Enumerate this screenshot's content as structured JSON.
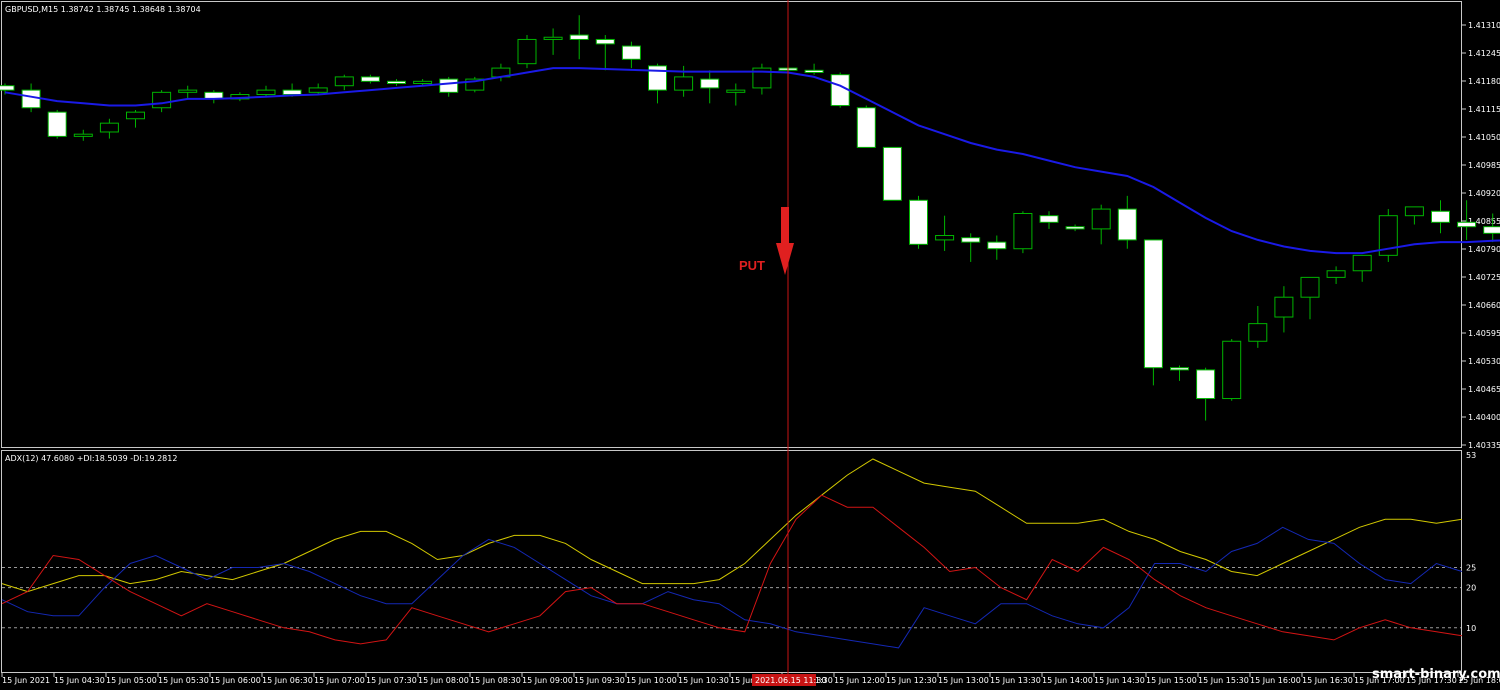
{
  "header": {
    "symbol_info": "GBPUSD,M15  1.38742 1.38745 1.38648 1.38704",
    "adx_info": "ADX(12) 47.6080 +DI:18.5039 -DI:19.2812"
  },
  "signal": {
    "label": "PUT",
    "direction": "down"
  },
  "cursor_time": "2021.06.15 11:30",
  "watermark": "smart-binary.com",
  "colors": {
    "background": "#000000",
    "bull": "#00b400",
    "bear_fill": "#ffffff",
    "ma": "#1a1ae6",
    "adx": "#d2c800",
    "plus_di": "#1428b4",
    "minus_di": "#d21414",
    "cursor": "#c81414",
    "signal": "#e02020"
  },
  "axes": {
    "price_labels": [
      "1.41310",
      "1.41245",
      "1.41180",
      "1.41115",
      "1.41050",
      "1.40985",
      "1.40920",
      "1.40855",
      "1.40790",
      "1.40725",
      "1.40660",
      "1.40595",
      "1.40530",
      "1.40465",
      "1.40400",
      "1.40335"
    ],
    "adx_labels": [
      "53",
      "25",
      "20",
      "10"
    ],
    "adx_levels": [
      25,
      20,
      10
    ],
    "time_labels": [
      "15 Jun 2021",
      "15 Jun 04:30",
      "15 Jun 05:00",
      "15 Jun 05:30",
      "15 Jun 06:00",
      "15 Jun 06:30",
      "15 Jun 07:00",
      "15 Jun 07:30",
      "15 Jun 08:00",
      "15 Jun 08:30",
      "15 Jun 09:00",
      "15 Jun 09:30",
      "15 Jun 10:00",
      "15 Jun 10:30",
      "15 Jun 11:00",
      "15 Jun 11:30",
      "15 Jun 12:00",
      "15 Jun 12:30",
      "15 Jun 13:00",
      "15 Jun 13:30",
      "15 Jun 14:00",
      "15 Jun 14:30",
      "15 Jun 15:00",
      "15 Jun 15:30",
      "15 Jun 16:00",
      "15 Jun 16:30",
      "15 Jun 17:00",
      "15 Jun 17:30",
      "15 Jun 18:00"
    ]
  },
  "chart_data": {
    "type": "candlestick",
    "price_range": [
      1.4032,
      1.4133
    ],
    "adx_range": [
      0,
      53
    ],
    "signal_index": 30,
    "candles": [
      [
        1.4114,
        1.41145,
        1.4112,
        1.4113
      ],
      [
        1.4113,
        1.41145,
        1.4108,
        1.4109
      ],
      [
        1.4108,
        1.41085,
        1.4102,
        1.41025
      ],
      [
        1.41025,
        1.4104,
        1.41015,
        1.4103
      ],
      [
        1.41035,
        1.41065,
        1.4102,
        1.41055
      ],
      [
        1.41065,
        1.41085,
        1.41045,
        1.4108
      ],
      [
        1.4109,
        1.4113,
        1.4108,
        1.41125
      ],
      [
        1.41125,
        1.4114,
        1.4111,
        1.4113
      ],
      [
        1.41125,
        1.4113,
        1.411,
        1.4111
      ],
      [
        1.4111,
        1.41125,
        1.41105,
        1.4112
      ],
      [
        1.4112,
        1.4114,
        1.41115,
        1.4113
      ],
      [
        1.4113,
        1.41145,
        1.41115,
        1.4112
      ],
      [
        1.41125,
        1.41145,
        1.4112,
        1.41135
      ],
      [
        1.4114,
        1.41165,
        1.4113,
        1.4116
      ],
      [
        1.4116,
        1.41165,
        1.41145,
        1.4115
      ],
      [
        1.4115,
        1.41155,
        1.4114,
        1.41145
      ],
      [
        1.41145,
        1.41155,
        1.4114,
        1.4115
      ],
      [
        1.41155,
        1.4116,
        1.41115,
        1.41125
      ],
      [
        1.4113,
        1.4116,
        1.41125,
        1.41155
      ],
      [
        1.4116,
        1.4119,
        1.4115,
        1.4118
      ],
      [
        1.4119,
        1.41255,
        1.4118,
        1.41245
      ],
      [
        1.41245,
        1.4127,
        1.4121,
        1.4125
      ],
      [
        1.41255,
        1.413,
        1.412,
        1.41245
      ],
      [
        1.41245,
        1.41255,
        1.41175,
        1.41235
      ],
      [
        1.4123,
        1.4124,
        1.4118,
        1.412
      ],
      [
        1.41185,
        1.4119,
        1.411,
        1.4113
      ],
      [
        1.4113,
        1.41185,
        1.41115,
        1.4116
      ],
      [
        1.41155,
        1.41175,
        1.411,
        1.41135
      ],
      [
        1.41125,
        1.41145,
        1.41095,
        1.4113
      ],
      [
        1.41135,
        1.4119,
        1.4112,
        1.4118
      ],
      [
        1.4118,
        1.4119,
        1.4114,
        1.41175
      ],
      [
        1.41175,
        1.4119,
        1.41165,
        1.4117
      ],
      [
        1.41165,
        1.4117,
        1.4109,
        1.41095
      ],
      [
        1.4109,
        1.41095,
        1.41035,
        1.41
      ],
      [
        1.41,
        1.4099,
        1.40935,
        1.4088
      ],
      [
        1.4088,
        1.4089,
        1.4077,
        1.4078
      ],
      [
        1.4079,
        1.40845,
        1.40765,
        1.408
      ],
      [
        1.40795,
        1.40805,
        1.4074,
        1.40785
      ],
      [
        1.40785,
        1.408,
        1.40745,
        1.4077
      ],
      [
        1.4077,
        1.40855,
        1.4076,
        1.4085
      ],
      [
        1.40845,
        1.40855,
        1.40815,
        1.4083
      ],
      [
        1.4082,
        1.40825,
        1.4081,
        1.40815
      ],
      [
        1.40815,
        1.4087,
        1.4078,
        1.4086
      ],
      [
        1.4086,
        1.4089,
        1.4077,
        1.4079
      ],
      [
        1.4079,
        1.4079,
        1.4046,
        1.405
      ],
      [
        1.405,
        1.40505,
        1.4047,
        1.40495
      ],
      [
        1.40495,
        1.405,
        1.4038,
        1.4043
      ],
      [
        1.4043,
        1.40565,
        1.40425,
        1.4056
      ],
      [
        1.4056,
        1.4064,
        1.40545,
        1.406
      ],
      [
        1.40615,
        1.40685,
        1.4058,
        1.4066
      ],
      [
        1.4066,
        1.40705,
        1.4061,
        1.40705
      ],
      [
        1.40705,
        1.4073,
        1.4069,
        1.4072
      ],
      [
        1.4072,
        1.4075,
        1.40695,
        1.40755
      ],
      [
        1.40755,
        1.4086,
        1.4074,
        1.40845
      ],
      [
        1.40845,
        1.4086,
        1.40825,
        1.40865
      ],
      [
        1.40855,
        1.4088,
        1.40805,
        1.4083
      ],
      [
        1.4083,
        1.4088,
        1.4079,
        1.4082
      ],
      [
        1.4082,
        1.4085,
        1.40785,
        1.40805
      ],
      [
        1.40805,
        1.4085,
        1.40765,
        1.408
      ],
      [
        1.408,
        1.4087,
        1.4077,
        1.4088
      ],
      [
        1.4088,
        1.40975,
        1.40835,
        1.40865
      ]
    ],
    "ma": [
      1.41125,
      1.41115,
      1.41105,
      1.411,
      1.41095,
      1.41095,
      1.411,
      1.4111,
      1.4111,
      1.41112,
      1.41115,
      1.41118,
      1.4112,
      1.41125,
      1.4113,
      1.41135,
      1.4114,
      1.41145,
      1.4115,
      1.4116,
      1.4117,
      1.4118,
      1.4118,
      1.41178,
      1.41176,
      1.41174,
      1.41172,
      1.41172,
      1.41172,
      1.41172,
      1.4117,
      1.4116,
      1.4114,
      1.4111,
      1.4108,
      1.4105,
      1.4103,
      1.4101,
      1.40995,
      1.40985,
      1.4097,
      1.40955,
      1.40945,
      1.40935,
      1.4091,
      1.40875,
      1.4084,
      1.4081,
      1.4079,
      1.40775,
      1.40765,
      1.4076,
      1.4076,
      1.4077,
      1.4078,
      1.40785,
      1.40785,
      1.40788,
      1.4079,
      1.40795,
      1.408
    ],
    "adx": [
      21,
      19,
      21,
      23,
      23,
      21,
      22,
      24,
      23,
      22,
      24,
      26,
      29,
      32,
      34,
      34,
      31,
      27,
      28,
      31,
      33,
      33,
      31,
      27,
      24,
      21,
      21,
      21,
      22,
      26,
      32,
      38,
      43,
      48,
      52,
      49,
      46,
      45,
      44,
      40,
      36,
      36,
      36,
      37,
      34,
      32,
      29,
      27,
      24,
      23,
      26,
      29,
      32,
      35,
      37,
      37,
      36,
      37
    ],
    "plus_di": [
      17,
      14,
      13,
      13,
      20,
      26,
      28,
      25,
      22,
      25,
      25,
      26,
      24,
      21,
      18,
      16,
      16,
      22,
      28,
      32,
      30,
      26,
      22,
      18,
      16,
      16,
      19,
      17,
      16,
      12,
      11,
      9,
      8,
      7,
      6,
      5,
      15,
      13,
      11,
      16,
      16,
      13,
      11,
      10,
      15,
      26,
      26,
      24,
      29,
      31,
      35,
      32,
      31,
      26,
      22,
      21,
      26,
      24
    ],
    "minus_di": [
      16,
      19,
      28,
      27,
      23,
      19,
      16,
      13,
      16,
      14,
      12,
      10,
      9,
      7,
      6,
      7,
      15,
      13,
      11,
      9,
      11,
      13,
      19,
      20,
      16,
      16,
      14,
      12,
      10,
      9,
      26,
      37,
      43,
      40,
      40,
      35,
      30,
      24,
      25,
      20,
      17,
      27,
      24,
      30,
      27,
      22,
      18,
      15,
      13,
      11,
      9,
      8,
      7,
      10,
      12,
      10,
      9,
      8
    ]
  }
}
